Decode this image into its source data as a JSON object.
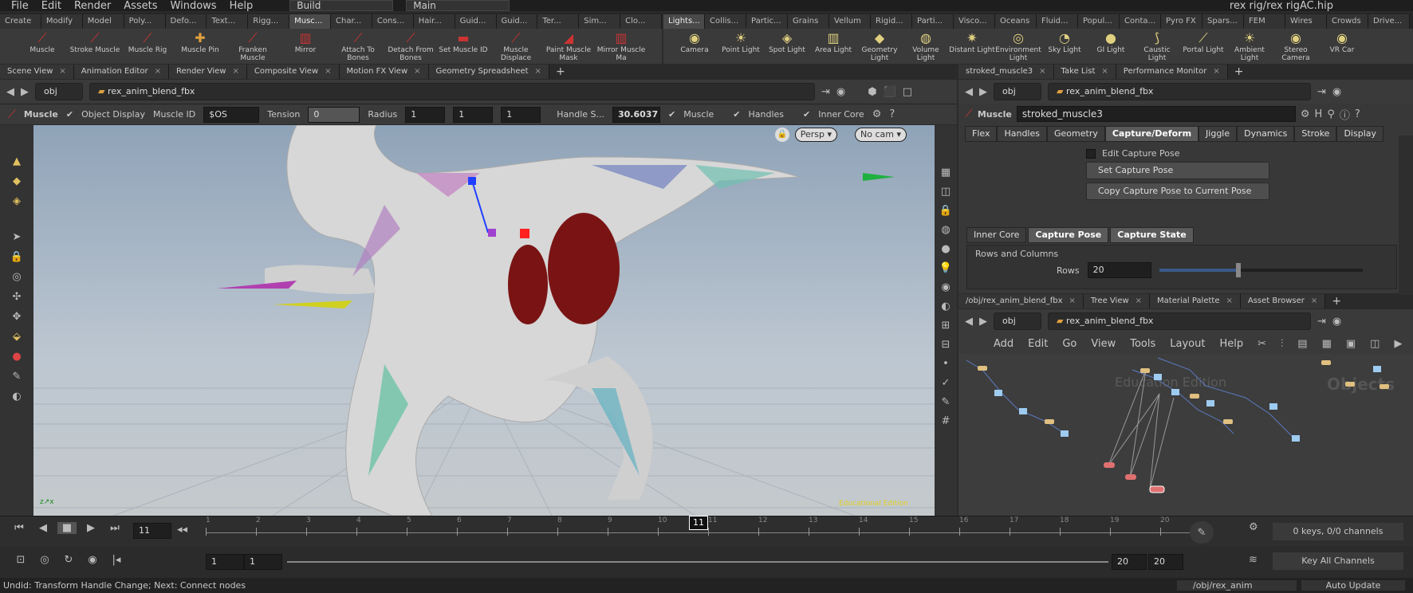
{
  "menubar": {
    "items": [
      "File",
      "Edit",
      "Render",
      "Assets",
      "Windows",
      "Help"
    ],
    "desktop": "Build",
    "scene": "Main",
    "title": "rex rig/rex rigAC.hip"
  },
  "shelf_tabs_left": [
    "Create",
    "Modify",
    "Model",
    "Poly...",
    "Defo...",
    "Text...",
    "Rigg...",
    "Musc...",
    "Char...",
    "Cons...",
    "Hair...",
    "Guid...",
    "Guid...",
    "Ter...",
    "Sim...",
    "Clo..."
  ],
  "shelf_tabs_right": [
    "Lights...",
    "Collis...",
    "Partic...",
    "Grains",
    "Vellum",
    "Rigid...",
    "Parti...",
    "Visco...",
    "Oceans",
    "Fluid...",
    "Popul...",
    "Conta...",
    "Pyro FX",
    "Spars...",
    "FEM",
    "Wires",
    "Crowds",
    "Drive..."
  ],
  "shelf_tools_left": [
    "Muscle",
    "Stroke Muscle",
    "Muscle Rig",
    "Muscle Pin",
    "Franken Muscle",
    "Mirror",
    "Attach To Bones",
    "Detach From Bones",
    "Set Muscle ID",
    "Muscle Displace",
    "Paint Muscle Mask",
    "Mirror Muscle Ma"
  ],
  "shelf_tools_right": [
    "Camera",
    "Point Light",
    "Spot Light",
    "Area Light",
    "Geometry Light",
    "Volume Light",
    "Distant Light",
    "Environment Light",
    "Sky Light",
    "GI Light",
    "Caustic Light",
    "Portal Light",
    "Ambient Light",
    "Stereo Camera",
    "VR Car"
  ],
  "left_tabs": [
    "Scene View",
    "Animation Editor",
    "Render View",
    "Composite View",
    "Motion FX View",
    "Geometry Spreadsheet"
  ],
  "left_path": {
    "root": "obj",
    "node": "rex_anim_blend_fbx"
  },
  "tool_bar": {
    "tool": "Muscle",
    "object_display": "Object Display",
    "muscle_id_label": "Muscle ID",
    "muscle_id": "$OS",
    "tension_label": "Tension",
    "tension": "0",
    "radius_label": "Radius",
    "radius": [
      "1",
      "1",
      "1"
    ],
    "handle_label": "Handle S...",
    "handle": "30.6037",
    "muscle": "Muscle",
    "handles": "Handles",
    "inner_core": "Inner Core"
  },
  "viewport": {
    "persp": "Persp ▾",
    "cam": "No cam ▾",
    "watermark": "Educational Edition"
  },
  "params_tabs": [
    "stroked_muscle3",
    "Take List",
    "Performance Monitor"
  ],
  "params": {
    "type": "Muscle",
    "name": "stroked_muscle3",
    "tabs": [
      "Flex",
      "Handles",
      "Geometry",
      "Capture/Deform",
      "Jiggle",
      "Dynamics",
      "Stroke",
      "Display"
    ],
    "edit_capture": "Edit Capture Pose",
    "set_capture": "Set Capture Pose",
    "copy_capture": "Copy Capture Pose to Current Pose",
    "subtabs": [
      "Inner Core",
      "Capture Pose",
      "Capture State"
    ],
    "rows_cols": "Rows and Columns",
    "rows_label": "Rows",
    "rows": "20"
  },
  "network_tabs": [
    "/obj/rex_anim_blend_fbx",
    "Tree View",
    "Material Palette",
    "Asset Browser"
  ],
  "network_menu": [
    "Add",
    "Edit",
    "Go",
    "View",
    "Tools",
    "Layout",
    "Help"
  ],
  "network_watermark": "Education Edition",
  "network_label": "Objects",
  "timeline": {
    "frame": "11",
    "ticks": [
      "1",
      "2",
      "3",
      "4",
      "5",
      "6",
      "7",
      "8",
      "9",
      "10",
      "11",
      "12",
      "13",
      "14",
      "15",
      "16",
      "17",
      "18",
      "19",
      "20"
    ],
    "start": "1",
    "start2": "1",
    "end": "20",
    "end2": "20",
    "keys": "0 keys, 0/0 channels",
    "key_all": "Key All Channels"
  },
  "status": {
    "message": "Undid: Transform Handle Change; Next: Connect nodes",
    "path": "/obj/rex_anim",
    "auto": "Auto Update"
  },
  "colors": {
    "accent": "#e0a040",
    "muscle": "#7a1414",
    "bg": "#2b2b2b"
  }
}
